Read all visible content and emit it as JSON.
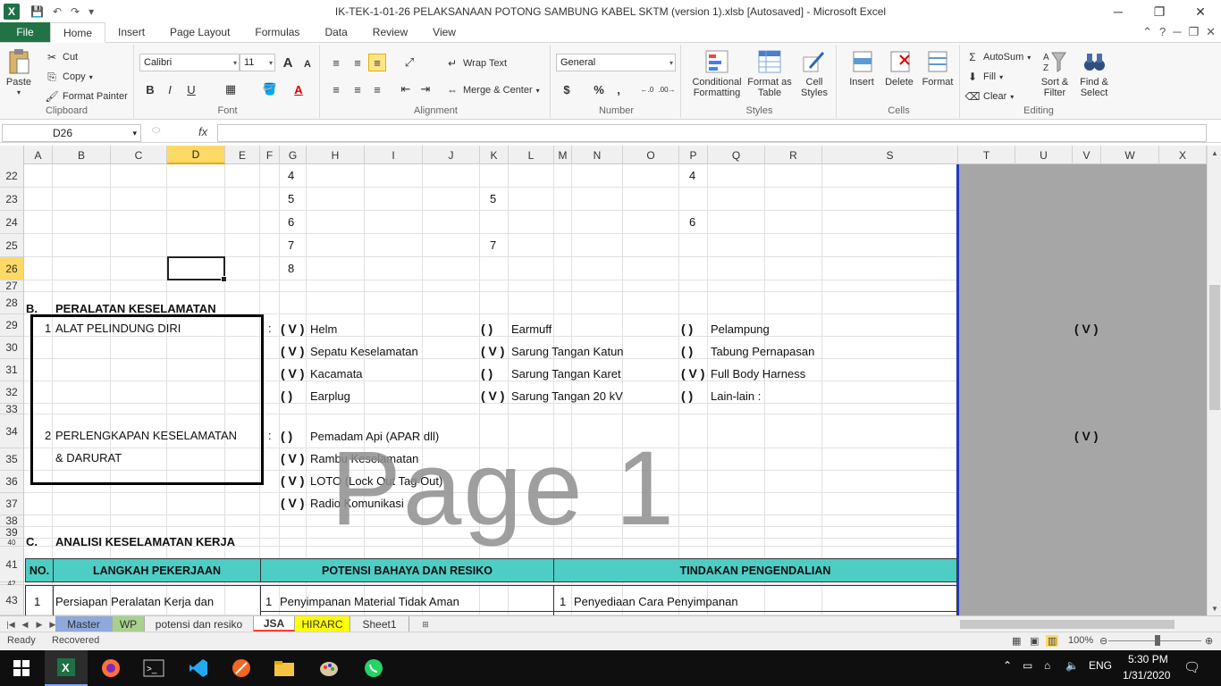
{
  "window": {
    "title": "IK-TEK-1-01-26 PELAKSANAAN POTONG SAMBUNG KABEL SKTM (version 1).xlsb [Autosaved]  -  Microsoft Excel",
    "app_icon": "X"
  },
  "ribbon_tabs": [
    "File",
    "Home",
    "Insert",
    "Page Layout",
    "Formulas",
    "Data",
    "Review",
    "View"
  ],
  "active_tab": "Home",
  "ribbon": {
    "clipboard": {
      "label": "Clipboard",
      "paste": "Paste",
      "cut": "Cut",
      "copy": "Copy",
      "format_painter": "Format Painter"
    },
    "font": {
      "label": "Font",
      "name": "Calibri",
      "size": "11",
      "bold": "B",
      "italic": "I",
      "underline": "U",
      "grow": "A",
      "shrink": "A",
      "font_color": "A"
    },
    "alignment": {
      "label": "Alignment",
      "wrap_text": "Wrap Text",
      "merge_center": "Merge & Center"
    },
    "number": {
      "label": "Number",
      "format": "General",
      "currency": "$",
      "percent": "%",
      "comma": ",",
      "inc_dec": ".0 .00",
      "dec_dec": ".00 →.0"
    },
    "styles": {
      "label": "Styles",
      "conditional": "Conditional Formatting",
      "format_table": "Format as Table",
      "cell_styles": "Cell Styles"
    },
    "cells": {
      "label": "Cells",
      "insert": "Insert",
      "delete": "Delete",
      "format": "Format"
    },
    "editing": {
      "label": "Editing",
      "autosum": "AutoSum",
      "fill": "Fill",
      "clear": "Clear",
      "sort_filter": "Sort & Filter",
      "find_select": "Find & Select"
    }
  },
  "formula_bar": {
    "name_box": "D26",
    "fx": "fx",
    "value": ""
  },
  "columns": [
    "A",
    "B",
    "C",
    "D",
    "E",
    "F",
    "G",
    "H",
    "I",
    "J",
    "K",
    "L",
    "M",
    "N",
    "O",
    "P",
    "Q",
    "R",
    "S",
    "T",
    "U",
    "V",
    "W",
    "X"
  ],
  "selected_column": "D",
  "rows": [
    "22",
    "23",
    "24",
    "25",
    "26",
    "27",
    "28",
    "29",
    "30",
    "31",
    "32",
    "33",
    "34",
    "35",
    "36",
    "37",
    "38",
    "39",
    "40",
    "41",
    "42",
    "43"
  ],
  "selected_row": "26",
  "cells": {
    "g22": "4",
    "p22": "4",
    "g23": "5",
    "k23": "5",
    "g24": "6",
    "p24": "6",
    "g25": "7",
    "k25": "7",
    "g26": "8",
    "b28_a": "B.",
    "b28_b": "PERALATAN KESELAMATAN",
    "r29_num": "1",
    "r29_label": "ALAT PELINDUNG DIRI",
    "colon29": ":",
    "r34_num": "2",
    "r34_label": "PERLENGKAPAN KESELAMATAN",
    "colon34": ":",
    "r35_label": "& DARURAT",
    "c39_a": "C.",
    "c39_b": "ANALISI KESELAMATAN KERJA",
    "h41_no": "NO.",
    "h41_step": "LANGKAH PEKERJAAN",
    "h41_risk": "POTENSI BAHAYA DAN RESIKO",
    "h41_control": "TINDAKAN PENGENDALIAN",
    "r43_no": "1",
    "r43_step": "Persiapan Peralatan Kerja dan",
    "r43_risk_no": "1",
    "r43_risk": "Penyimpanan Material Tidak Aman",
    "r43_ctrl_no": "1",
    "r43_ctrl": "Penyediaan Cara Penyimpanan",
    "side_check_29": "( V )",
    "side_check_34": "( V )"
  },
  "checklist": [
    {
      "row": 29,
      "col": "g",
      "mark": "( V )",
      "text": "Helm"
    },
    {
      "row": 29,
      "col": "k",
      "mark": "(     )",
      "text": "Earmuff"
    },
    {
      "row": 29,
      "col": "p",
      "mark": "(     )",
      "text": "Pelampung"
    },
    {
      "row": 30,
      "col": "g",
      "mark": "( V )",
      "text": "Sepatu Keselamatan"
    },
    {
      "row": 30,
      "col": "k",
      "mark": "( V )",
      "text": "Sarung Tangan Katun"
    },
    {
      "row": 30,
      "col": "p",
      "mark": "(     )",
      "text": "Tabung Pernapasan"
    },
    {
      "row": 31,
      "col": "g",
      "mark": "( V )",
      "text": "Kacamata"
    },
    {
      "row": 31,
      "col": "k",
      "mark": "(     )",
      "text": "Sarung Tangan Karet"
    },
    {
      "row": 31,
      "col": "p",
      "mark": "( V )",
      "text": "Full Body Harness"
    },
    {
      "row": 32,
      "col": "g",
      "mark": "(     )",
      "text": "Earplug"
    },
    {
      "row": 32,
      "col": "k",
      "mark": "( V )",
      "text": "Sarung Tangan 20 kV"
    },
    {
      "row": 32,
      "col": "p",
      "mark": "(     )",
      "text": "Lain-lain :"
    },
    {
      "row": 34,
      "col": "g",
      "mark": "(     )",
      "text": "Pemadam Api (APAR dll)"
    },
    {
      "row": 35,
      "col": "g",
      "mark": "( V )",
      "text": "Rambu Keselamatan"
    },
    {
      "row": 36,
      "col": "g",
      "mark": "( V )",
      "text": "LOTO (Lock Out Tag Out)"
    },
    {
      "row": 37,
      "col": "g",
      "mark": "( V )",
      "text": "Radio Komunikasi"
    }
  ],
  "watermark": "Page 1",
  "sheet_tabs": [
    {
      "name": "Master",
      "color": "#8ea9db"
    },
    {
      "name": "WP",
      "color": "#a9d08e"
    },
    {
      "name": "potensi dan resiko",
      "color": ""
    },
    {
      "name": "JSA",
      "color": "#ff0000"
    },
    {
      "name": "HIRARC",
      "color": "#ffff00"
    },
    {
      "name": "Sheet1",
      "color": ""
    }
  ],
  "active_sheet": "JSA",
  "status": {
    "ready": "Ready",
    "recovered": "Recovered",
    "zoom": "100%"
  },
  "taskbar": {
    "lang": "ENG",
    "time": "5:30 PM",
    "date": "1/31/2020"
  }
}
